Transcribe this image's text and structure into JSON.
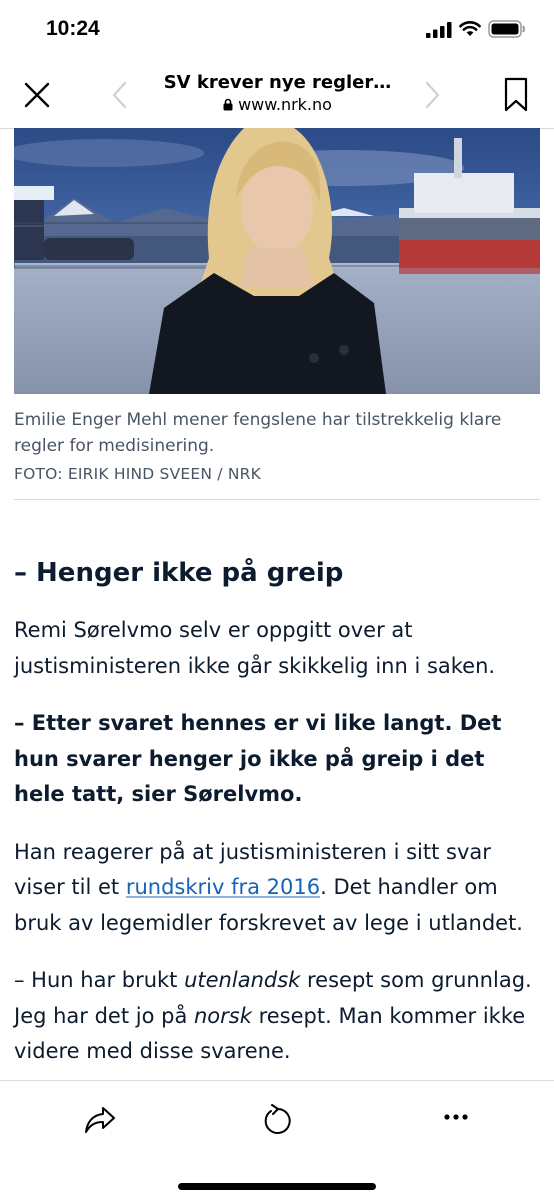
{
  "status_bar": {
    "time": "10:24"
  },
  "nav": {
    "title": "SV krever nye regler…",
    "url": "www.nrk.no"
  },
  "photo": {
    "caption": "Emilie Enger Mehl mener fengslene har tilstrekkelig klare regler for medisinering.",
    "credit": "FOTO: EIRIK HIND SVEEN / NRK"
  },
  "article": {
    "heading": "– Henger ikke på greip",
    "p1": "Remi Sørelvmo selv er oppgitt over at justisministeren ikke går skikkelig inn i saken.",
    "quote": "– Etter svaret hennes er vi like langt. Det hun svarer henger jo ikke på greip i det hele tatt, sier Sørelvmo.",
    "p3_before": "Han reagerer på at justisministeren i sitt svar viser til et ",
    "p3_link": "rundskriv fra 2016",
    "p3_after": ". Det handler om bruk av legemidler forskrevet av lege i utlandet.",
    "p4_a": "– Hun har brukt ",
    "p4_em1": "utenlandsk",
    "p4_b": " resept som grunnlag. Jeg har det jo på ",
    "p4_em2": "norsk",
    "p4_c": " resept. Man kommer ikke videre med disse svarene."
  },
  "icons": {
    "close": "close-icon",
    "back": "chevron-left-icon",
    "forward": "chevron-right-icon",
    "bookmark": "bookmark-icon",
    "share": "share-icon",
    "reload": "reload-icon",
    "more": "more-icon"
  },
  "colors": {
    "text": "#0c1b2e",
    "link": "#1463b8",
    "muted": "#4a5563"
  }
}
